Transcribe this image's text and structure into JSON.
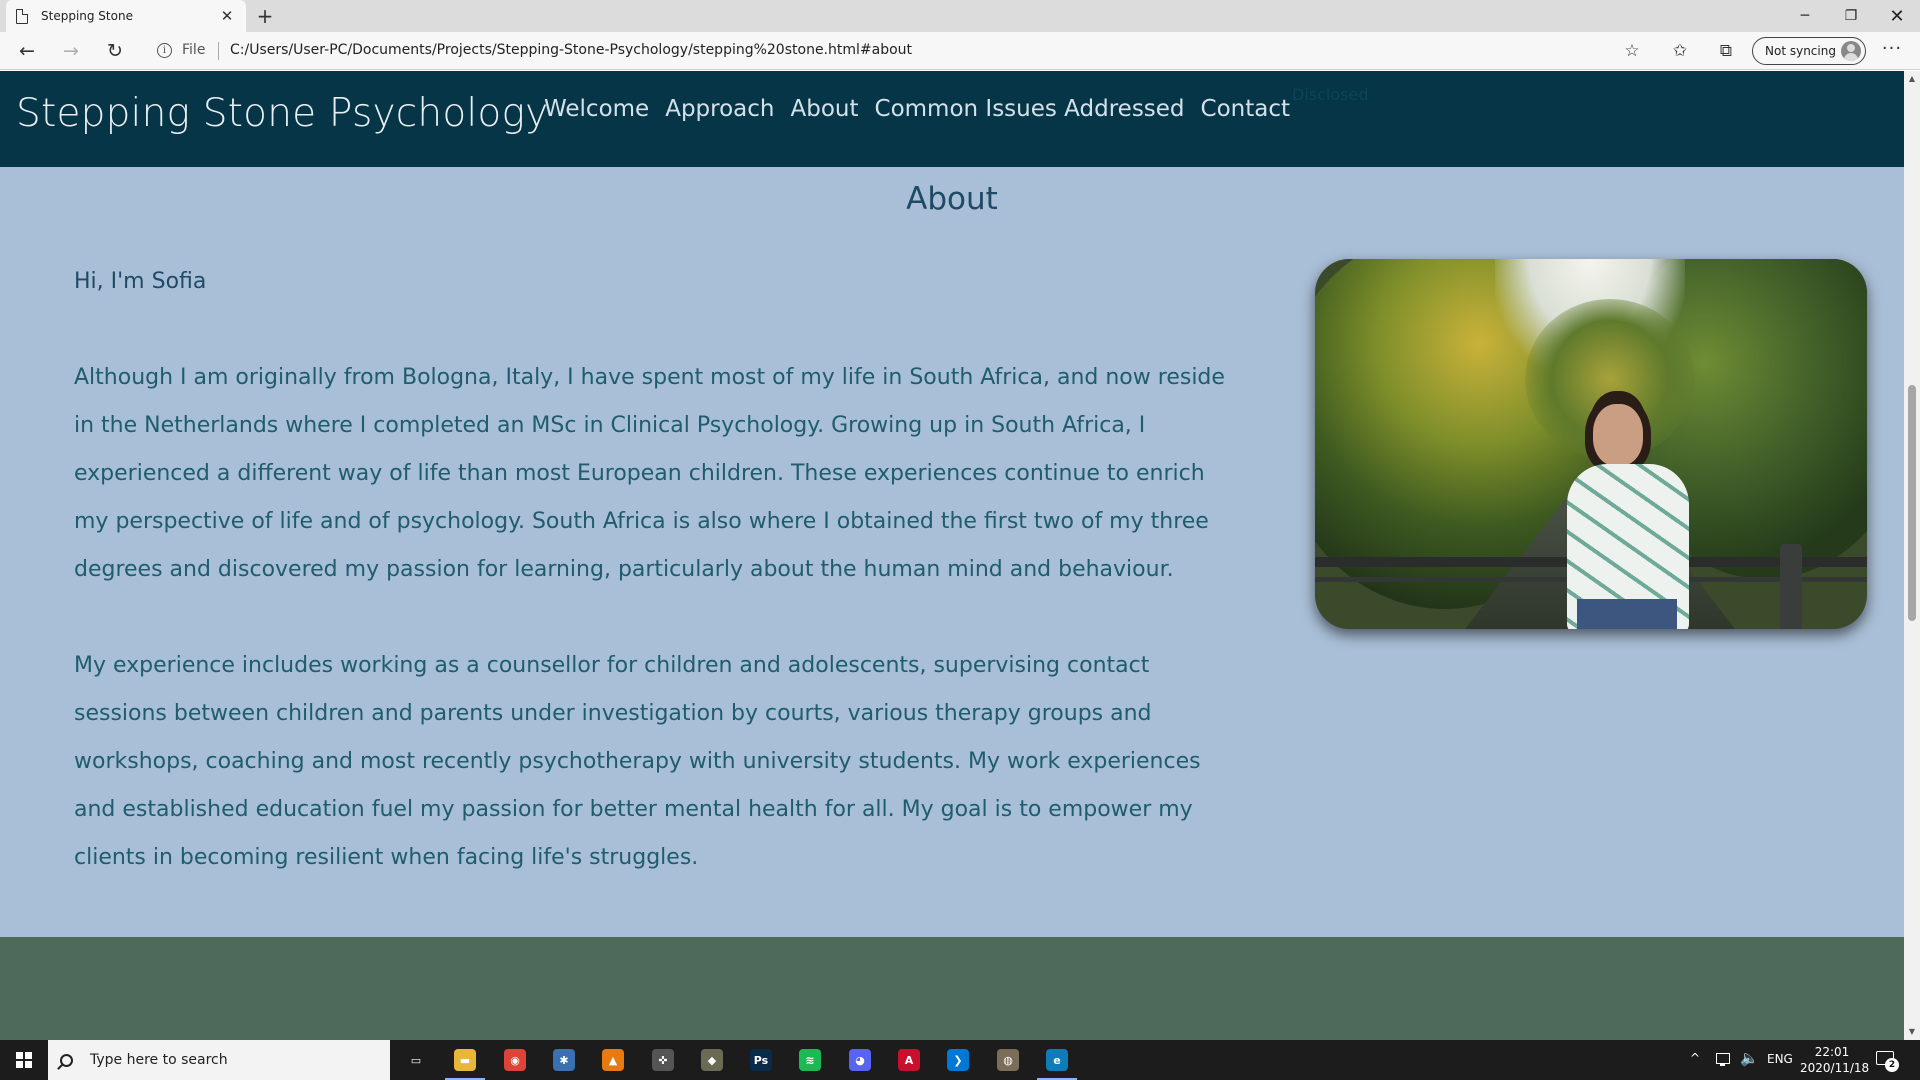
{
  "browser": {
    "tab_title": "Stepping Stone",
    "tab_close": "✕",
    "new_tab": "+",
    "window_controls": {
      "minimize": "─",
      "maximize": "❐",
      "close": "✕"
    },
    "nav": {
      "back": "←",
      "forward": "→",
      "reload": "↻"
    },
    "info_icon": "i",
    "scheme_label": "File",
    "url": "C:/Users/User-PC/Documents/Projects/Stepping-Stone-Psychology/stepping%20stone.html#about",
    "favorite_icon": "☆",
    "favorites_icon": "✩",
    "collections_icon": "⧉",
    "profile_label": "Not syncing",
    "menu_icon": "···"
  },
  "site": {
    "brand": "Stepping Stone Psychology",
    "nav_links": [
      "Welcome",
      "Approach",
      "About",
      "Common Issues Addressed",
      "Contact"
    ],
    "ghost_link": "Disclosed",
    "accent_colors": {
      "nav_bg": "#053546",
      "page_bg": "#a9bfd7",
      "footer_bg": "#4d6b5b"
    }
  },
  "about": {
    "heading": "About",
    "greeting": "Hi, I'm Sofia",
    "paragraphs": [
      "Although I am originally from Bologna, Italy, I have spent most of my life in South Africa, and now reside in the Netherlands where I completed an MSc in Clinical Psychology. Growing up in South Africa, I experienced a different way of life than most European children. These experiences continue to enrich my perspective of life and of psychology. South Africa is also where I obtained the first two of my three degrees and discovered my passion for learning, particularly about the human mind and behaviour.",
      "My experience includes working as a counsellor for children and adolescents, supervising contact sessions between children and parents under investigation by courts, various therapy groups and workshops, coaching and most recently psychotherapy with university students. My work experiences and established education fuel my passion for better mental health for all. My goal is to empower my clients in becoming resilient when facing life's struggles."
    ]
  },
  "scrollbar": {
    "up": "▲",
    "down": "▼"
  },
  "taskbar": {
    "search_placeholder": "Type here to search",
    "apps": [
      {
        "name": "task-view",
        "glyph": "▭",
        "color": "#1c1c1c"
      },
      {
        "name": "file-explorer",
        "glyph": "▬",
        "color": "#e8b73a"
      },
      {
        "name": "chrome",
        "glyph": "◉",
        "color": "#db4437"
      },
      {
        "name": "davinci-resolve",
        "glyph": "✱",
        "color": "#3a6fb0"
      },
      {
        "name": "vlc",
        "glyph": "▲",
        "color": "#e87a12"
      },
      {
        "name": "game-controller",
        "glyph": "✜",
        "color": "#555555"
      },
      {
        "name": "turtle-app",
        "glyph": "◆",
        "color": "#6b6b55"
      },
      {
        "name": "photoshop",
        "glyph": "Ps",
        "color": "#0a2a4a"
      },
      {
        "name": "spotify",
        "glyph": "≋",
        "color": "#1db954"
      },
      {
        "name": "discord",
        "glyph": "◕",
        "color": "#5865f2"
      },
      {
        "name": "acrobat",
        "glyph": "A",
        "color": "#c8102e"
      },
      {
        "name": "vscode",
        "glyph": "❯",
        "color": "#0078d4"
      },
      {
        "name": "gimp",
        "glyph": "◍",
        "color": "#7a6e58"
      },
      {
        "name": "edge",
        "glyph": "e",
        "color": "#0f7bb8"
      }
    ],
    "tray": {
      "chevron": "^",
      "volume": "🔈",
      "language": "ENG",
      "time": "22:01",
      "date": "2020/11/18",
      "notification_count": "2"
    }
  }
}
